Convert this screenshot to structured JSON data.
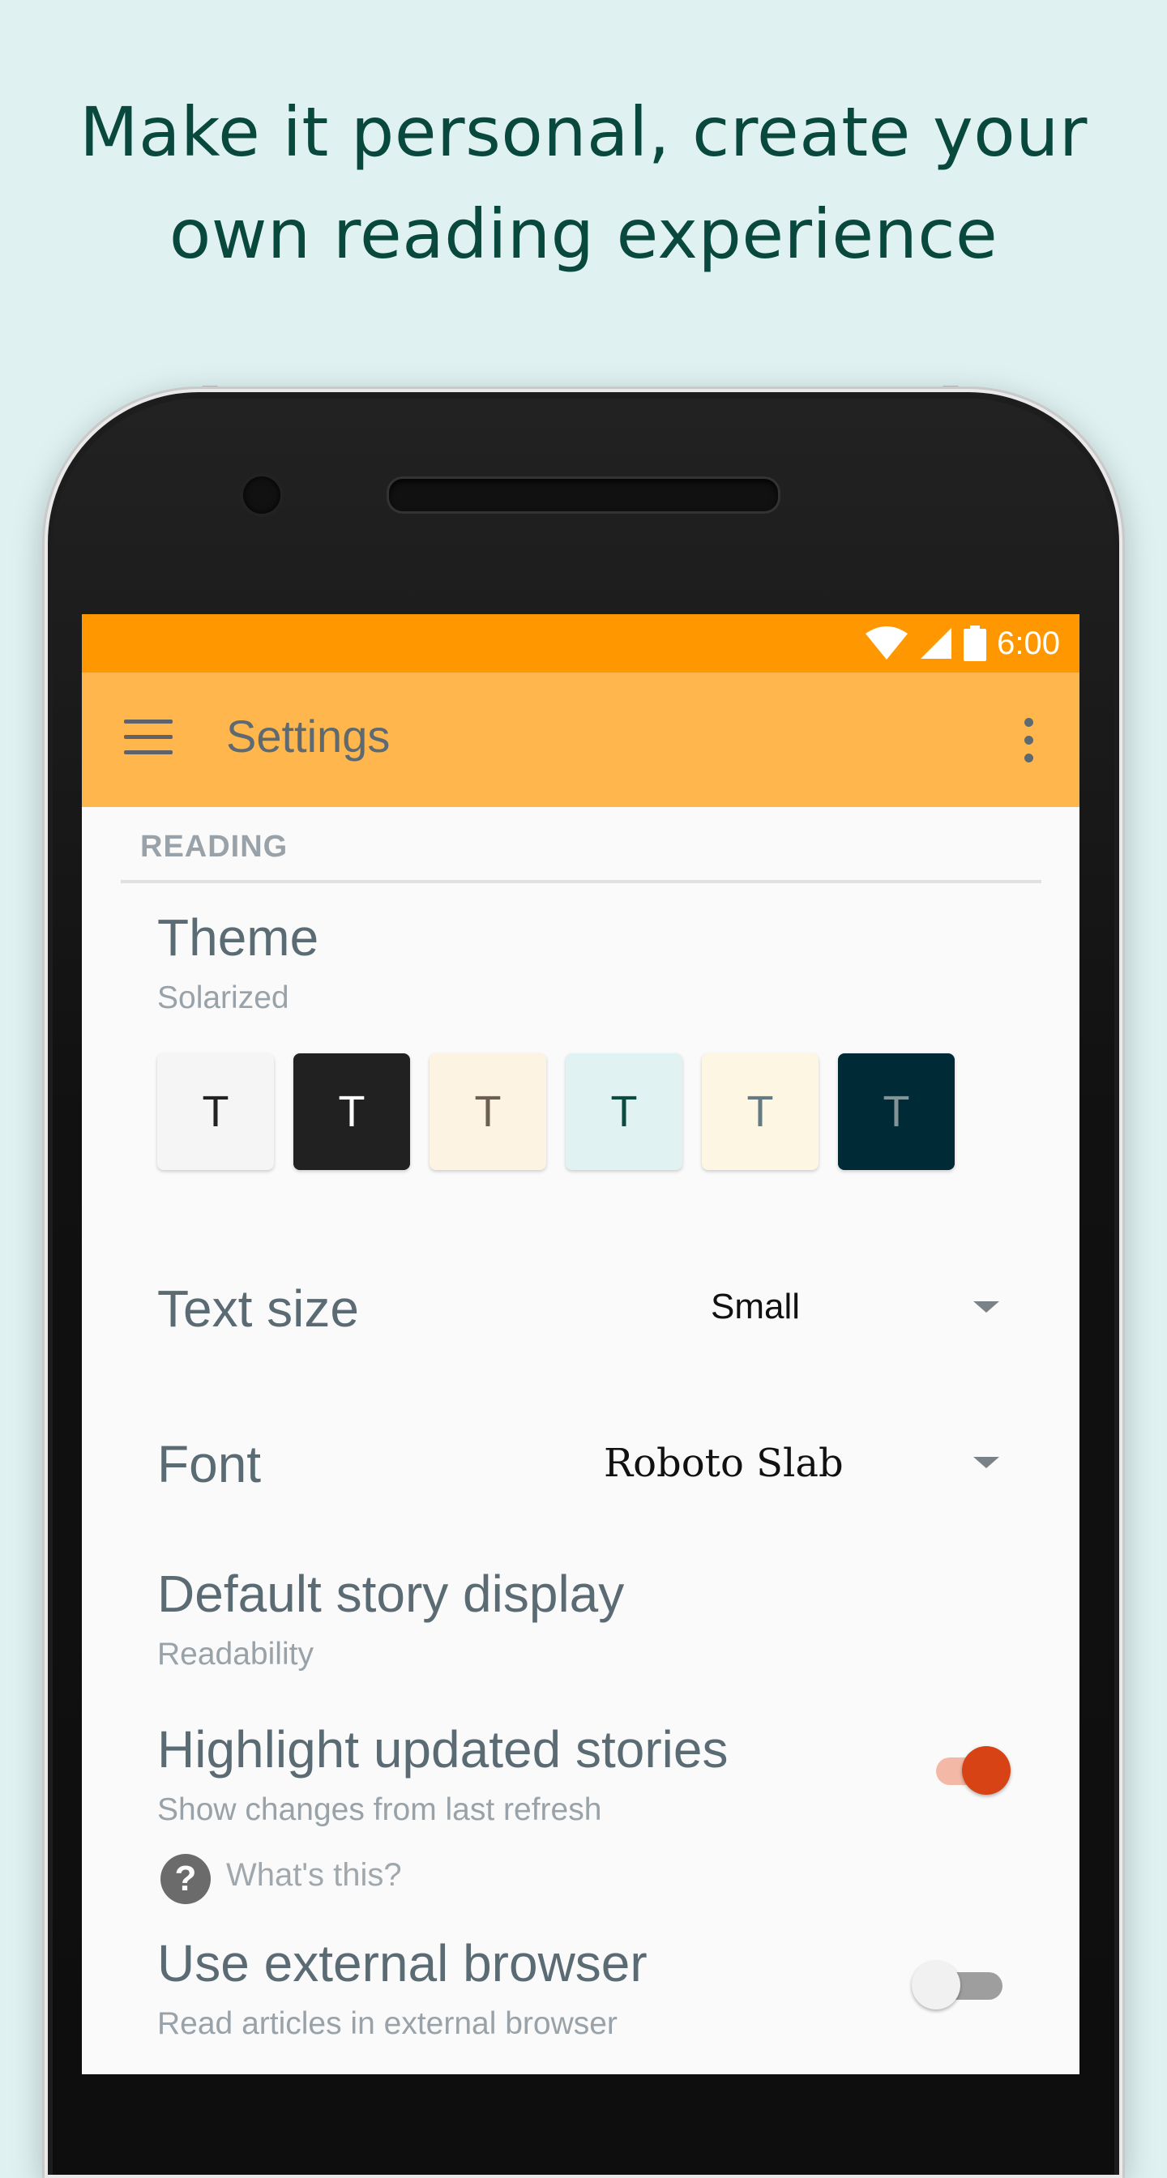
{
  "headline": {
    "line1": "Make it personal, create your",
    "line2": "own reading experience"
  },
  "status_bar": {
    "time": "6:00",
    "icons": [
      "wifi-icon",
      "cell-signal-icon",
      "battery-icon"
    ]
  },
  "toolbar": {
    "menu_icon": "hamburger-menu-icon",
    "title": "Settings",
    "overflow_icon": "more-vert-icon"
  },
  "section": {
    "header": "READING"
  },
  "theme": {
    "title": "Theme",
    "value": "Solarized",
    "swatches": [
      {
        "label": "T",
        "bg": "#f5f5f5",
        "fg": "#222222"
      },
      {
        "label": "T",
        "bg": "#212121",
        "fg": "#ffffff"
      },
      {
        "label": "T",
        "bg": "#fdf3e3",
        "fg": "#6d5f53"
      },
      {
        "label": "T",
        "bg": "#e0f2f1",
        "fg": "#0a4d40"
      },
      {
        "label": "T",
        "bg": "#fdf6e3",
        "fg": "#657b83"
      },
      {
        "label": "T",
        "bg": "#002b36",
        "fg": "#839496"
      }
    ]
  },
  "text_size": {
    "title": "Text size",
    "value": "Small"
  },
  "font": {
    "title": "Font",
    "value": "Roboto Slab"
  },
  "default_display": {
    "title": "Default story display",
    "value": "Readability"
  },
  "highlight": {
    "title": "Highlight updated stories",
    "subtitle": "Show changes from last refresh",
    "enabled": true,
    "help_label": "What's this?",
    "help_icon": "?"
  },
  "external_browser": {
    "title": "Use external browser",
    "subtitle": "Read articles in external browser",
    "enabled": false
  },
  "colors": {
    "status_bar": "#ff9800",
    "toolbar": "#ffb74d",
    "switch_on_thumb": "#d84315",
    "switch_on_track": "#f4b8a6",
    "switch_off_thumb": "#f1f1f1",
    "switch_off_track": "#9e9e9e"
  }
}
